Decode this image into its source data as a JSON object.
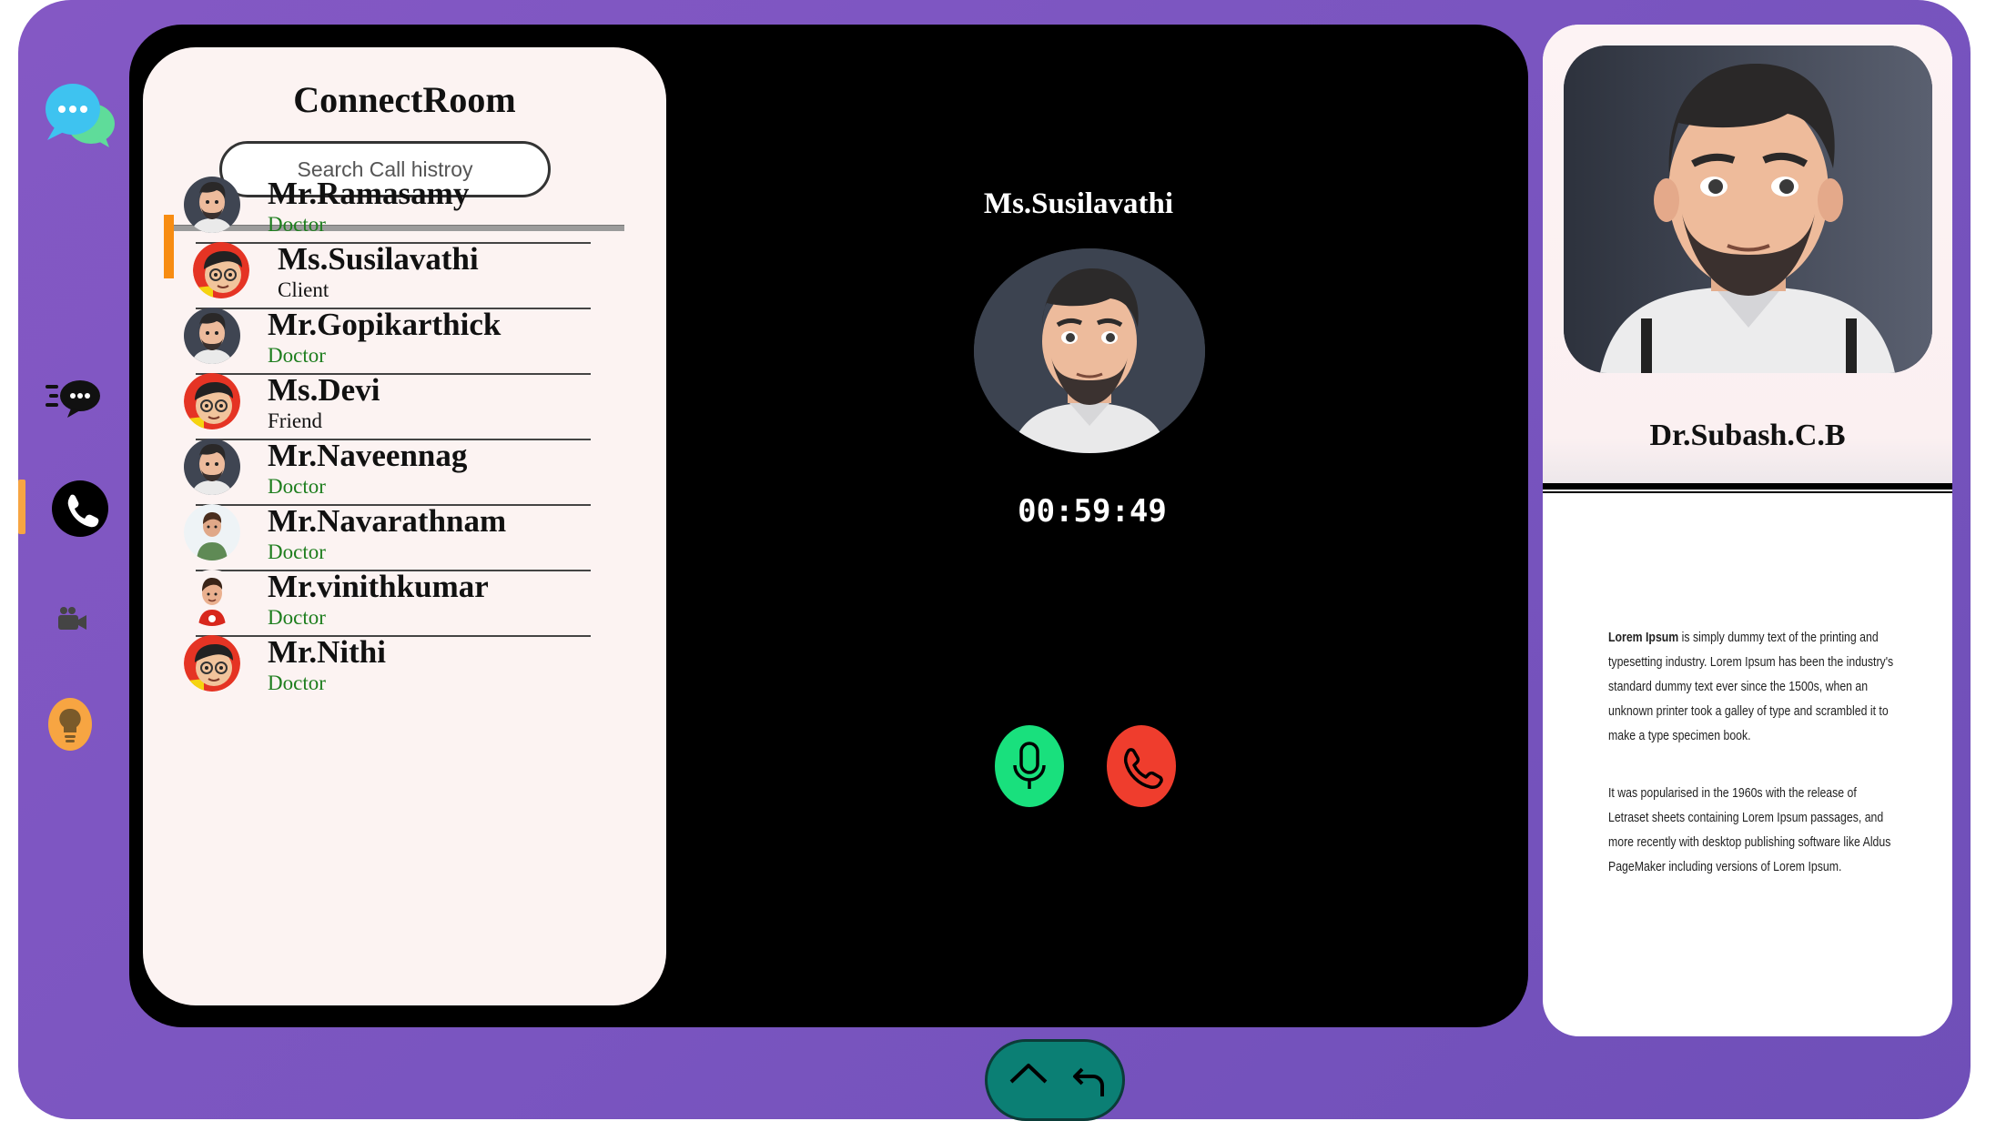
{
  "app": {
    "title": "ConnectRoom"
  },
  "search": {
    "placeholder": "Search Call histroy"
  },
  "contacts": [
    {
      "name": "Mr.Ramasamy",
      "role": "Doctor",
      "avatar": "man-beard-avatar"
    },
    {
      "name": "Ms.Susilavathi",
      "role": "Client",
      "avatar": "boy-glasses-avatar",
      "active": true
    },
    {
      "name": "Mr.Gopikarthick",
      "role": "Doctor",
      "avatar": "man-beard-avatar"
    },
    {
      "name": "Ms.Devi",
      "role": "Friend",
      "avatar": "boy-glasses-avatar"
    },
    {
      "name": "Mr.Naveennag",
      "role": "Doctor",
      "avatar": "man-beard-avatar"
    },
    {
      "name": "Mr.Navarathnam",
      "role": "Doctor",
      "avatar": "boy-green-shirt-avatar"
    },
    {
      "name": "Mr.vinithkumar",
      "role": "Doctor",
      "avatar": "man-red-shirt-avatar"
    },
    {
      "name": "Mr.Nithi",
      "role": "Doctor",
      "avatar": "boy-glasses-avatar"
    }
  ],
  "call": {
    "caller_name": "Ms.Susilavathi",
    "timer": "00:59:49",
    "mic_icon": "microphone-icon",
    "end_icon": "phone-hangup-icon"
  },
  "profile": {
    "name": "Dr.Subash.C.B",
    "bio_lead": "Lorem Ipsum",
    "bio_p1": " is simply dummy text of the printing and typesetting industry. Lorem Ipsum has been the industry's standard dummy text ever since the 1500s, when an unknown printer took a galley of type and scrambled it to make a type specimen book.",
    "bio_p2": "It was popularised in the 1960s with the release of Letraset sheets containing Lorem Ipsum passages, and more recently with desktop publishing software like Aldus PageMaker including versions of Lorem Ipsum."
  },
  "rail": [
    "chat-bubbles-icon",
    "fast-chat-icon",
    "phone-icon",
    "video-camera-icon",
    "lightbulb-icon"
  ],
  "colors": {
    "frame": "#7a55c0",
    "accent": "#f78c12",
    "role_green": "#1e7e1e",
    "mic": "#19e07d",
    "end_call": "#ef3d2d",
    "nav": "#0b7f74"
  }
}
